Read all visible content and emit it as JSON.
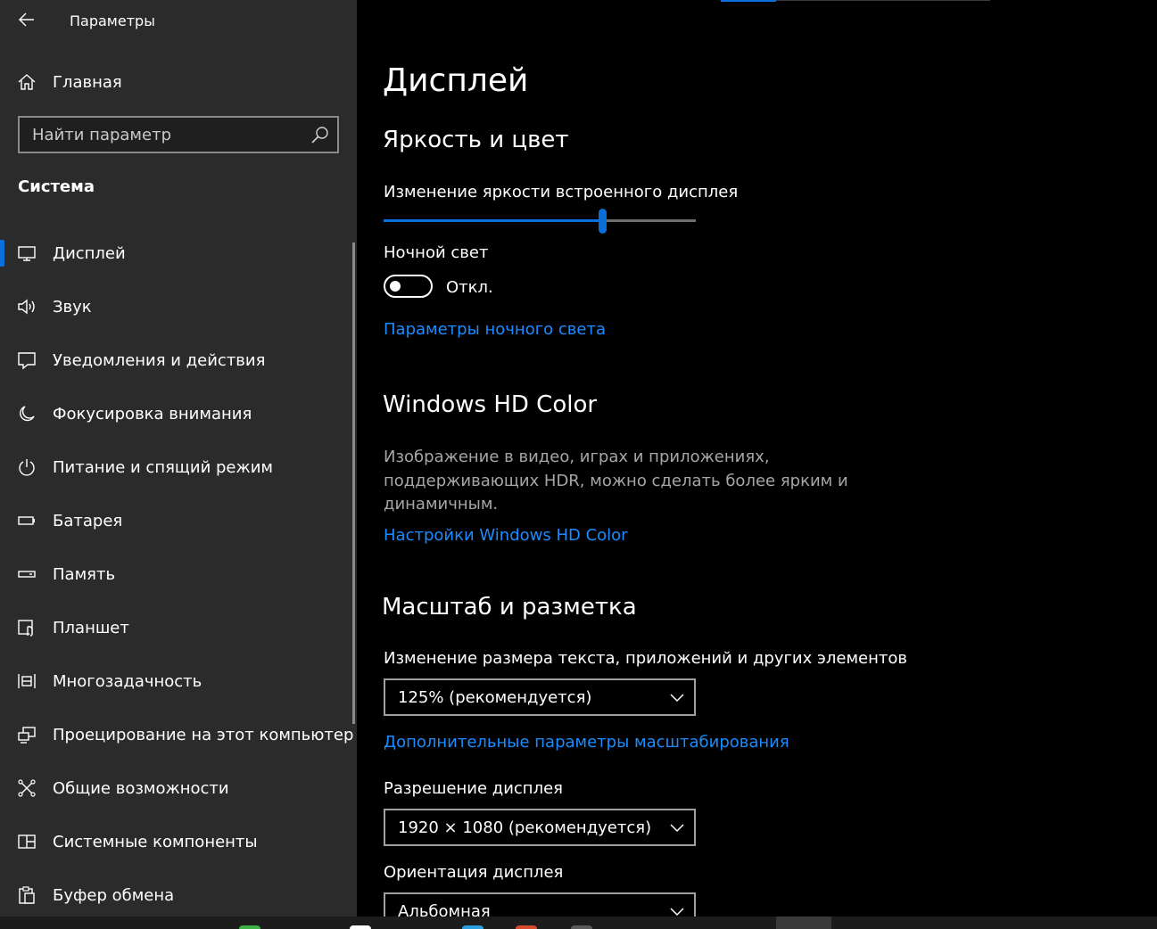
{
  "app": {
    "title": "Параметры"
  },
  "sidebar": {
    "home_label": "Главная",
    "search": {
      "placeholder": "Найти параметр"
    },
    "section": "Система",
    "items": [
      {
        "label": "Дисплей",
        "icon": "monitor-icon",
        "active": true
      },
      {
        "label": "Звук",
        "icon": "speaker-icon"
      },
      {
        "label": "Уведомления и действия",
        "icon": "notification-icon"
      },
      {
        "label": "Фокусировка внимания",
        "icon": "moon-icon"
      },
      {
        "label": "Питание и спящий режим",
        "icon": "power-icon"
      },
      {
        "label": "Батарея",
        "icon": "battery-icon"
      },
      {
        "label": "Память",
        "icon": "storage-icon"
      },
      {
        "label": "Планшет",
        "icon": "tablet-icon"
      },
      {
        "label": "Многозадачность",
        "icon": "multitasking-icon"
      },
      {
        "label": "Проецирование на этот компьютер",
        "icon": "projecting-icon"
      },
      {
        "label": "Общие возможности",
        "icon": "shared-experiences-icon"
      },
      {
        "label": "Системные компоненты",
        "icon": "system-components-icon"
      },
      {
        "label": "Буфер обмена",
        "icon": "clipboard-icon"
      }
    ]
  },
  "main": {
    "title": "Дисплей",
    "brightness": {
      "heading": "Яркость и цвет",
      "label": "Изменение яркости встроенного дисплея",
      "value": 0.7
    },
    "night_light": {
      "label": "Ночной свет",
      "state": "Откл.",
      "link": "Параметры ночного света"
    },
    "hdr": {
      "heading": "Windows HD Color",
      "description": "Изображение в видео, играх и приложениях, поддерживающих HDR, можно сделать более ярким и динамичным.",
      "link": "Настройки Windows HD Color"
    },
    "scale": {
      "heading": "Масштаб и разметка",
      "label": "Изменение размера текста, приложений и других элементов",
      "value": "125% (рекомендуется)",
      "link": "Дополнительные параметры масштабирования"
    },
    "resolution": {
      "label": "Разрешение дисплея",
      "value": "1920 × 1080 (рекомендуется)"
    },
    "orientation": {
      "label": "Ориентация дисплея",
      "value": "Альбомная"
    }
  },
  "colors": {
    "accent": "#0a6fd9",
    "link": "#1a8cff",
    "sidebar_bg": "#2b2b2b",
    "content_bg": "#000000"
  }
}
